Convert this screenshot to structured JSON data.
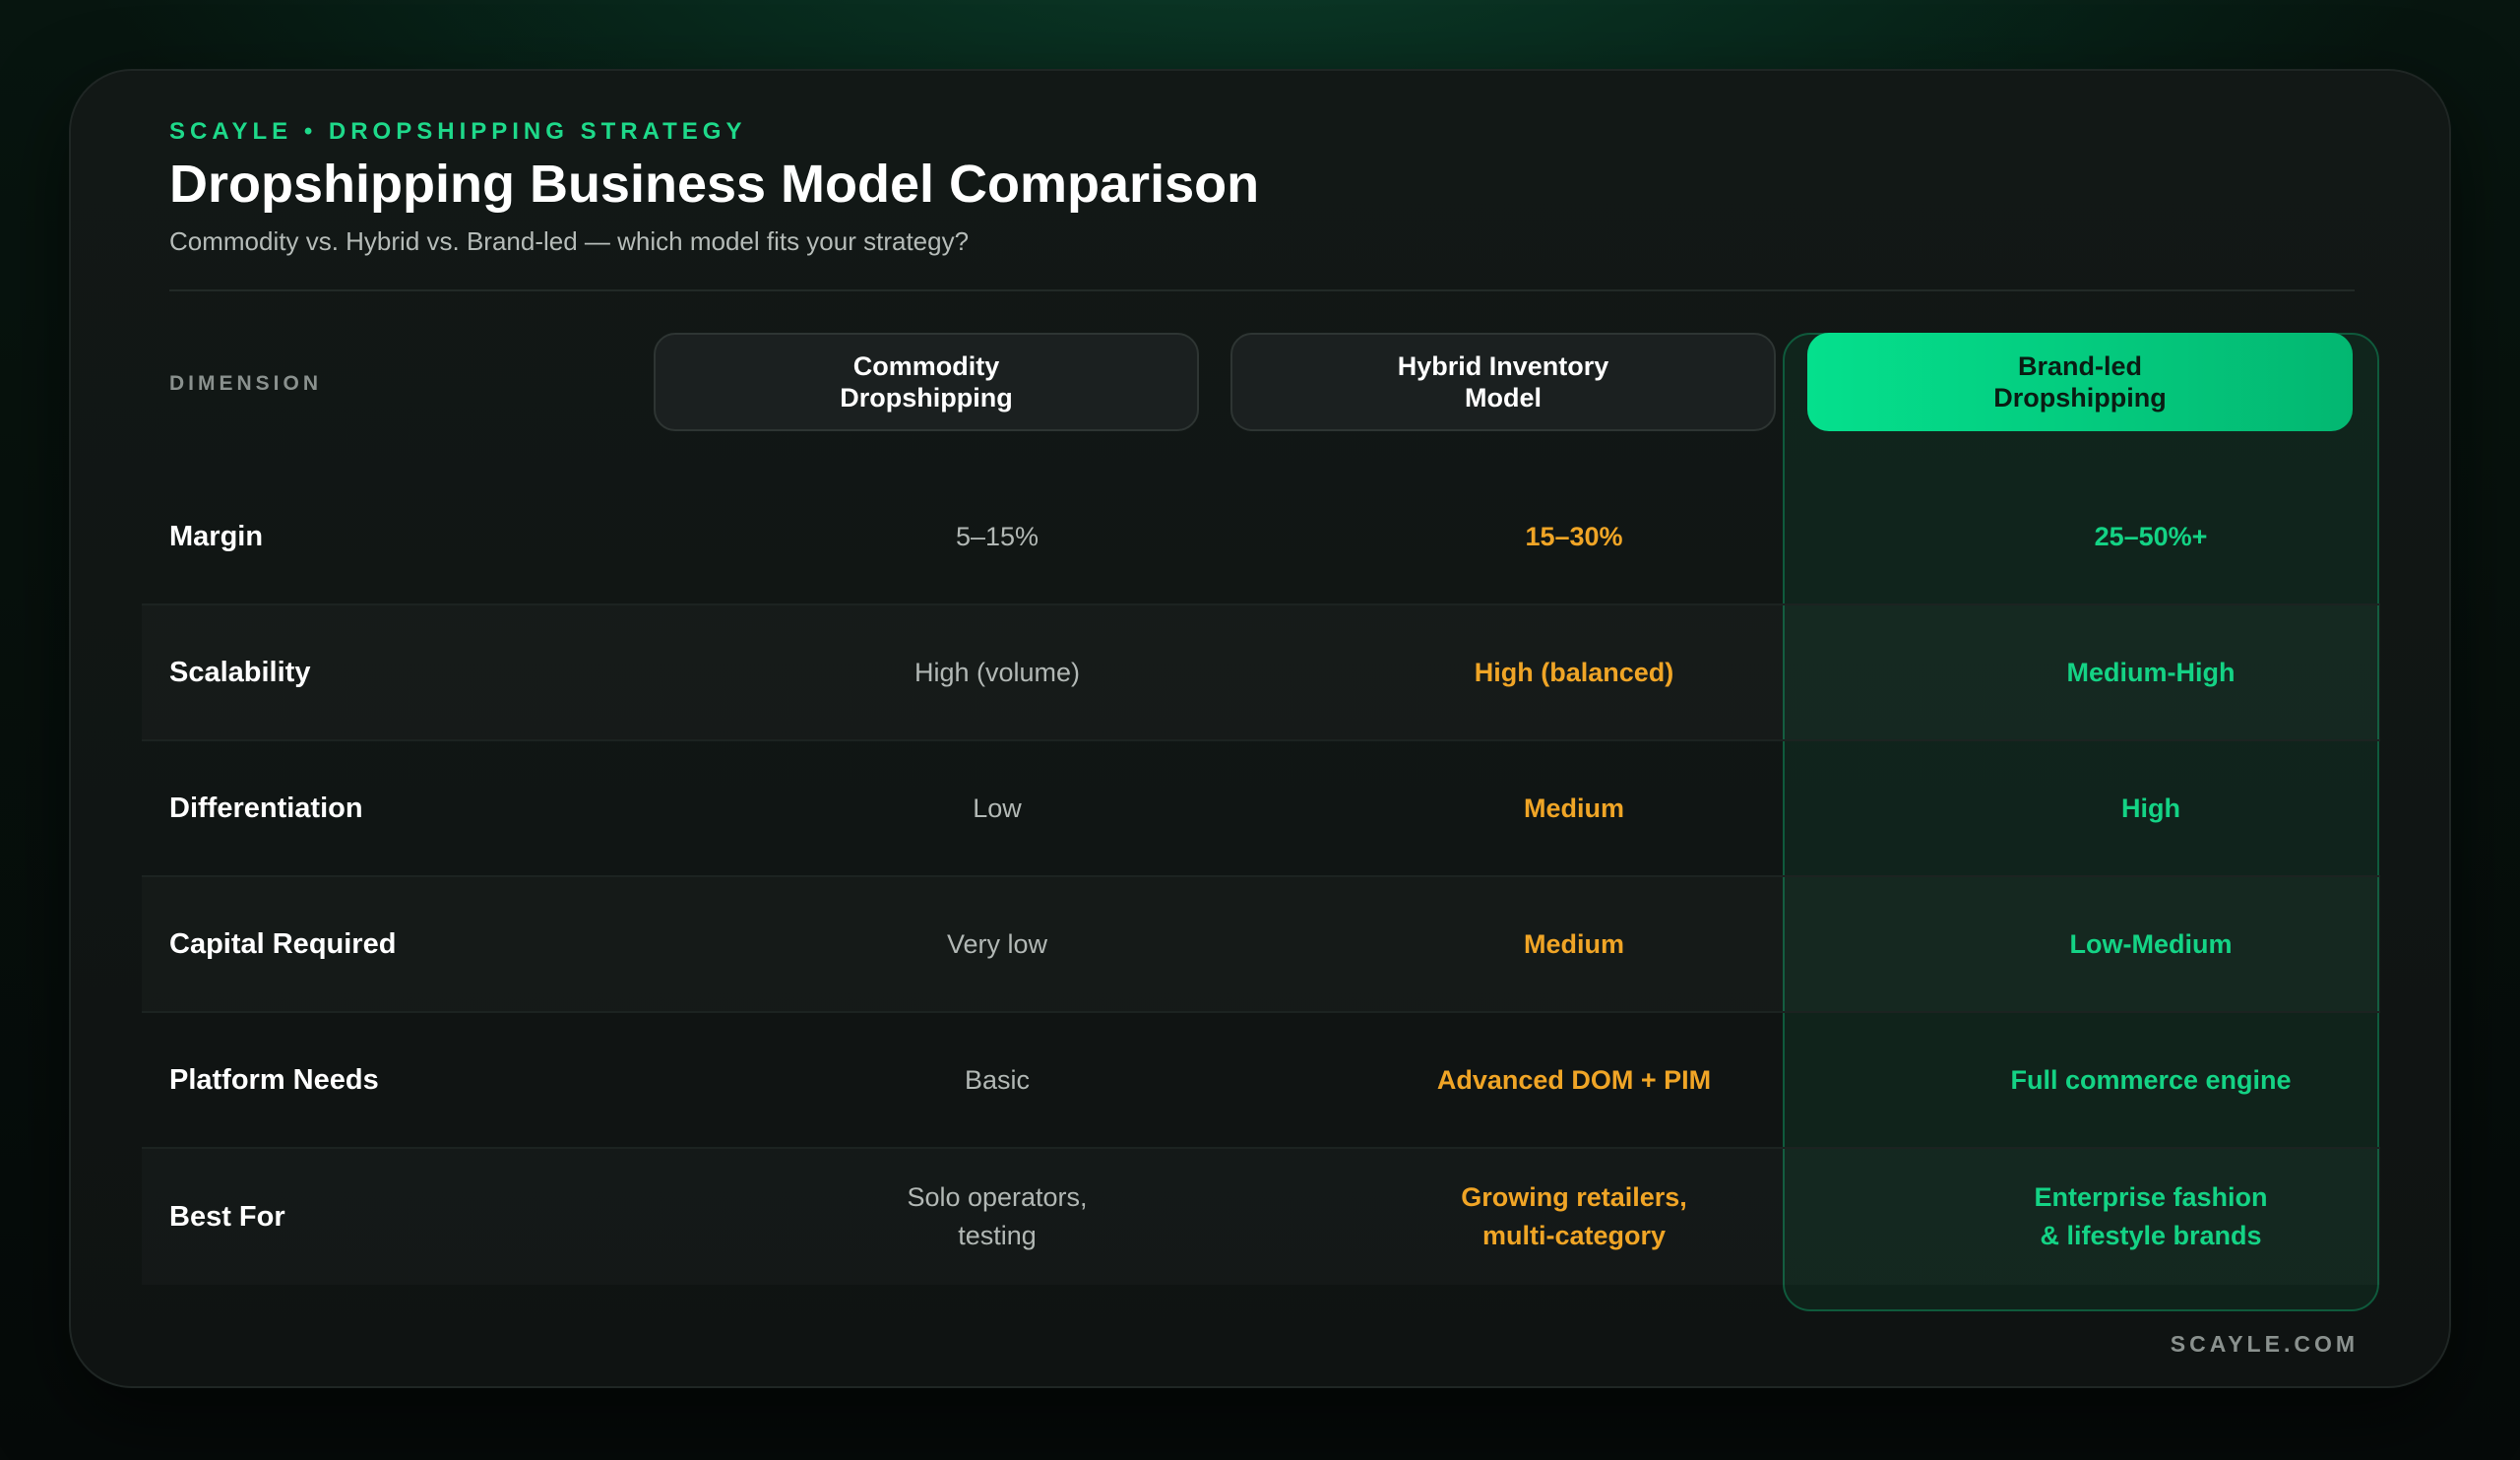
{
  "header": {
    "eyebrow": "SCAYLE • DROPSHIPPING STRATEGY",
    "title": "Dropshipping Business Model Comparison",
    "subtitle": "Commodity vs. Hybrid vs. Brand-led — which model fits your strategy?"
  },
  "table": {
    "dimension_label": "DIMENSION",
    "columns": [
      "Commodity\nDropshipping",
      "Hybrid Inventory\nModel",
      "Brand-led\nDropshipping"
    ],
    "rows": [
      {
        "label": "Margin",
        "values": [
          "5–15%",
          "15–30%",
          "25–50%+"
        ]
      },
      {
        "label": "Scalability",
        "values": [
          "High (volume)",
          "High (balanced)",
          "Medium-High"
        ]
      },
      {
        "label": "Differentiation",
        "values": [
          "Low",
          "Medium",
          "High"
        ]
      },
      {
        "label": "Capital Required",
        "values": [
          "Very low",
          "Medium",
          "Low-Medium"
        ]
      },
      {
        "label": "Platform Needs",
        "values": [
          "Basic",
          "Advanced DOM + PIM",
          "Full commerce engine"
        ]
      },
      {
        "label": "Best For",
        "values": [
          "Solo operators,\ntesting",
          "Growing retailers,\nmulti-category",
          "Enterprise fashion\n& lifestyle brands"
        ]
      }
    ]
  },
  "footer": {
    "site": "SCAYLE.COM"
  },
  "colors": {
    "accent_green": "#1ed98a",
    "featured_header": "#05e08d",
    "hybrid_orange": "#f0a526",
    "muted_text": "#b2b8b5"
  }
}
